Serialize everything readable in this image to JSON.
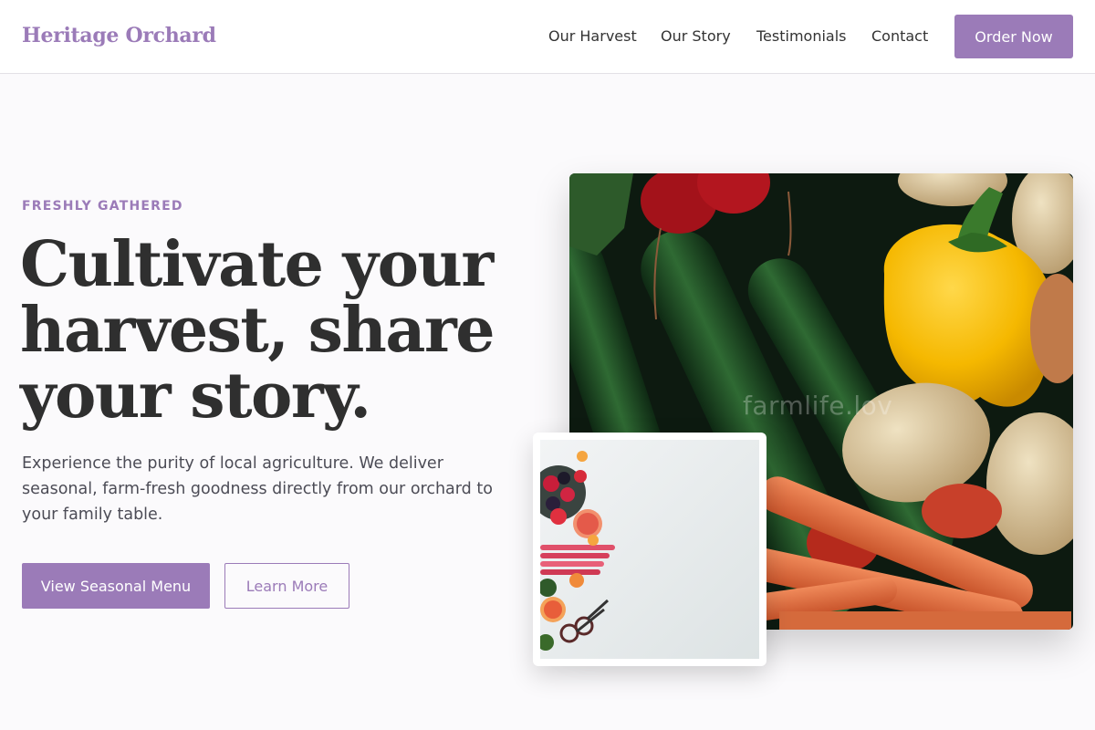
{
  "header": {
    "brand": "Heritage Orchard",
    "nav": [
      "Our Harvest",
      "Our Story",
      "Testimonials",
      "Contact"
    ],
    "cta_label": "Order Now"
  },
  "hero": {
    "eyebrow": "FRESHLY GATHERED",
    "headline_lines": [
      "Cultivate your",
      "harvest, share",
      "your story."
    ],
    "lead": "Experience the purity of local agriculture. We deliver seasonal, farm-fresh goodness directly from our orchard to your family table.",
    "primary_button": "View Seasonal Menu",
    "secondary_button": "Learn More"
  },
  "images": {
    "main_image_watermark": "farmlife.lov"
  },
  "colors": {
    "accent": "#9b7bb8",
    "text_dark": "#2f2f2f",
    "background": "#fbfafc"
  }
}
